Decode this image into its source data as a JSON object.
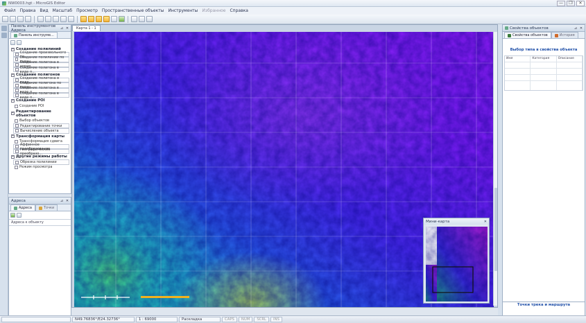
{
  "window": {
    "title": "NW0003.hgt - MicroGIS Editor",
    "min": "—",
    "max": "❐",
    "close": "✕"
  },
  "menu": [
    {
      "label": "Файл"
    },
    {
      "label": "Правка"
    },
    {
      "label": "Вид"
    },
    {
      "label": "Масштаб"
    },
    {
      "label": "Просмотр"
    },
    {
      "label": "Пространственные объекты"
    },
    {
      "label": "Инструменты"
    },
    {
      "label": "Избранное",
      "dim": true
    },
    {
      "label": "Справка"
    }
  ],
  "left_panel": {
    "title": "Панель инструментов Адреса",
    "tab_label": "Панель инструме...",
    "groups": [
      {
        "title": "Создание полилиний",
        "tools": [
          "Создание произвольного по...",
          "Создание полилинии по задан...",
          "Создание полигона в априо...",
          "Создание полигона в виде п..."
        ]
      },
      {
        "title": "Создание полигонов",
        "tools": [
          "Создание полигона в виде...",
          "Создание полигона по задан...",
          "Создание полигона в виде п...",
          "Создание полигона в виде п..."
        ]
      },
      {
        "title": "Создание POI",
        "tools": [
          "Создание POI"
        ]
      },
      {
        "title": "Редактирование объектов",
        "tools": [
          "Выбор объектов",
          "Редактирование точки",
          "Вычисление объекта"
        ]
      },
      {
        "title": "Трансформация карты",
        "tools": [
          "Трансформация сдвига",
          "Аффинное преобразование",
          "Географические преобразо..."
        ]
      },
      {
        "title": "Другие режимы работы",
        "tools": [
          "Обрезка полилинии",
          "Режим просмотра"
        ]
      }
    ]
  },
  "address_panel": {
    "title": "Адреса",
    "tab_active": "Адреса",
    "tab_inactive": "Точки",
    "row_label": "Адреса к объекту"
  },
  "map": {
    "tab": "Карта 1 - 1"
  },
  "minimap": {
    "title": "Мини-карта",
    "close": "✕"
  },
  "right_panel": {
    "title": "Свойства объектов",
    "tab_active": "Свойства объектов",
    "tab_inactive": "История",
    "heading": "Выбор типа в свойства объекта",
    "columns": [
      "Имя",
      "Категория",
      "Описание"
    ],
    "footer": "Точки трека и маршрута"
  },
  "status": {
    "coords": "N49.76836°/E24.32736°",
    "scale": "1 : 69000",
    "mode": "Раскладка",
    "flags": [
      "CAPS",
      "NUM",
      "SCRL",
      "INS"
    ]
  },
  "colors": {
    "panel_header": "#cfdbe9",
    "accent_text": "#1f4fa8",
    "map_low": "#7b1ff5",
    "map_high": "#1ec9a4"
  }
}
